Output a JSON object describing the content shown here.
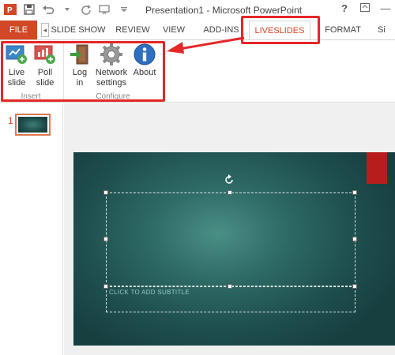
{
  "window": {
    "title": "Presentation1 - Microsoft PowerPoint",
    "help": "?",
    "minimize": "—"
  },
  "tabs": {
    "file": "FILE",
    "slide_show": "SLIDE SHOW",
    "review": "REVIEW",
    "view": "VIEW",
    "add_ins": "ADD-INS",
    "liveslides": "LIVESLIDES",
    "format": "FORMAT",
    "signin_partial": "Si"
  },
  "ribbon": {
    "insert_group": {
      "label": "Insert",
      "buttons": [
        {
          "line1": "Live",
          "line2": "slide",
          "icon": "live-slide-icon"
        },
        {
          "line1": "Poll",
          "line2": "slide",
          "icon": "poll-slide-icon"
        }
      ]
    },
    "configure_group": {
      "label": "Configure",
      "buttons": [
        {
          "line1": "Log",
          "line2": "in",
          "icon": "login-icon"
        },
        {
          "line1": "Network",
          "line2": "settings",
          "icon": "gear-icon"
        },
        {
          "line1": "About",
          "line2": "",
          "icon": "info-icon"
        }
      ]
    }
  },
  "thumbnails": {
    "number": "1"
  },
  "slide": {
    "subtitle_placeholder": "CLICK TO ADD SUBTITLE"
  },
  "colors": {
    "accent": "#d24726",
    "highlight": "#e52727",
    "slide_bg": "#2e6a66",
    "slide_tab": "#b81d1d"
  }
}
